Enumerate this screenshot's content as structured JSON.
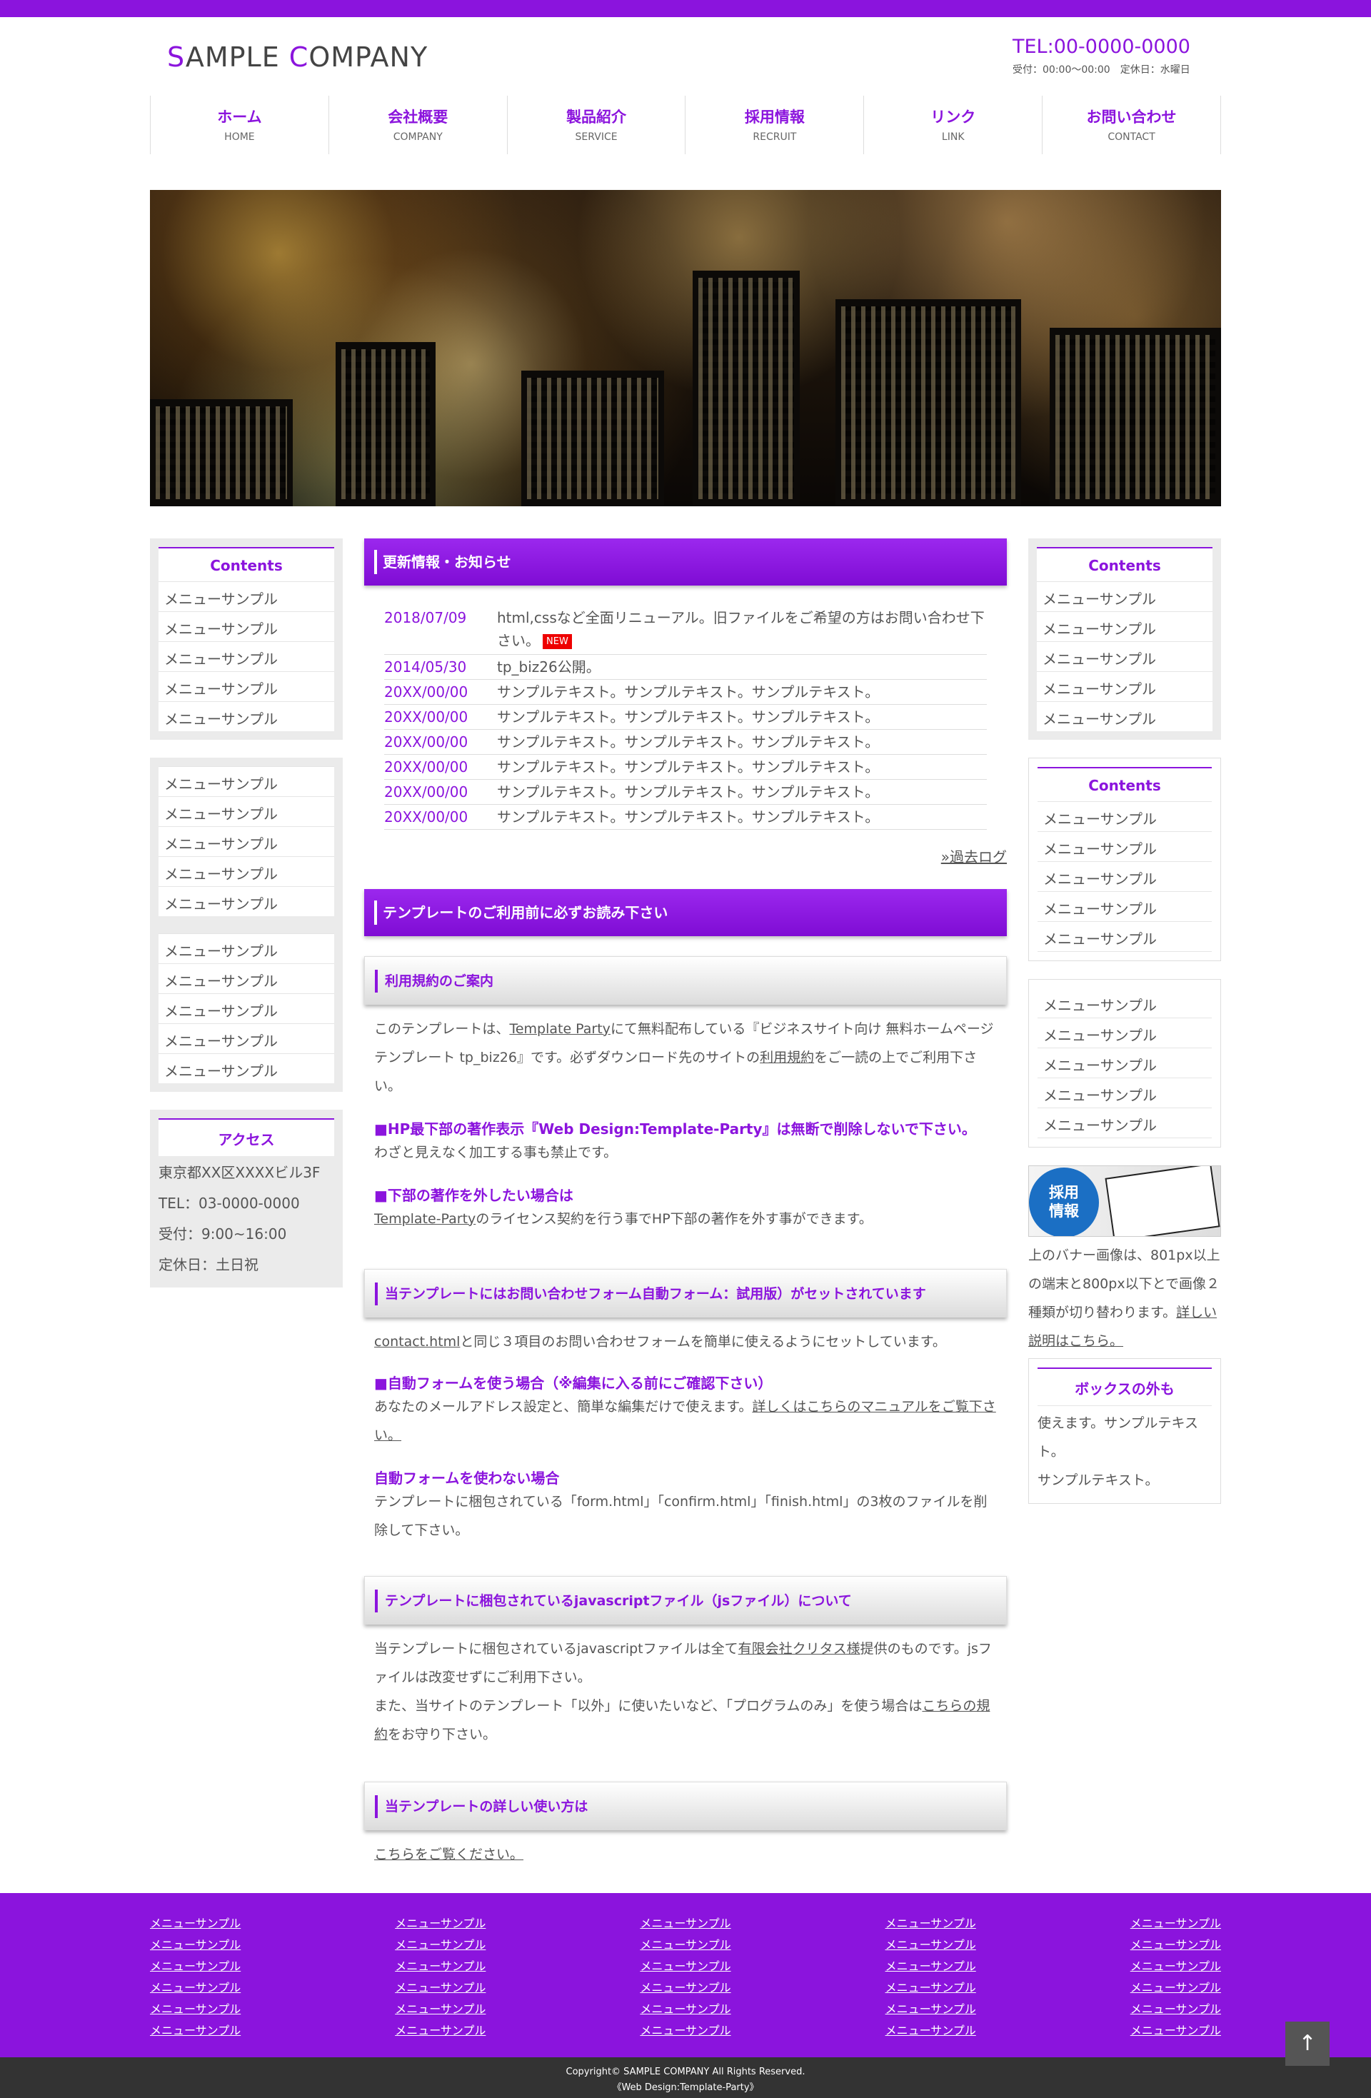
{
  "header": {
    "logo": {
      "first_initial": "S",
      "first_rest": "AMPLE ",
      "second_initial": "C",
      "second_rest": "OMPANY"
    },
    "tel": "TEL:00-0000-0000",
    "hours": "受付：00:00～00:00　定休日：水曜日"
  },
  "nav": [
    {
      "jp": "ホーム",
      "en": "HOME"
    },
    {
      "jp": "会社概要",
      "en": "COMPANY"
    },
    {
      "jp": "製品紹介",
      "en": "SERVICE"
    },
    {
      "jp": "採用情報",
      "en": "RECRUIT"
    },
    {
      "jp": "リンク",
      "en": "LINK"
    },
    {
      "jp": "お問い合わせ",
      "en": "CONTACT"
    }
  ],
  "left": {
    "box1_title": "Contents",
    "box1_items": [
      "メニューサンプル",
      "メニューサンプル",
      "メニューサンプル",
      "メニューサンプル",
      "メニューサンプル"
    ],
    "box2_items": [
      "メニューサンプル",
      "メニューサンプル",
      "メニューサンプル",
      "メニューサンプル",
      "メニューサンプル"
    ],
    "box3_items": [
      "メニューサンプル",
      "メニューサンプル",
      "メニューサンプル",
      "メニューサンプル",
      "メニューサンプル"
    ],
    "access_title": "アクセス",
    "access_lines": [
      "東京都XX区XXXXビル3F",
      "TEL：03-0000-0000",
      "受付：9:00~16:00",
      "定休日：土日祝"
    ]
  },
  "news": {
    "title": "更新情報・お知らせ",
    "badge": "NEW",
    "items": [
      {
        "date": "2018/07/09",
        "text": "html,cssなど全面リニューアル。旧ファイルをご希望の方はお問い合わせ下さい。"
      },
      {
        "date": "2014/05/30",
        "text": "tp_biz26公開。"
      },
      {
        "date": "20XX/00/00",
        "text": "サンプルテキスト。サンプルテキスト。サンプルテキスト。"
      },
      {
        "date": "20XX/00/00",
        "text": "サンプルテキスト。サンプルテキスト。サンプルテキスト。"
      },
      {
        "date": "20XX/00/00",
        "text": "サンプルテキスト。サンプルテキスト。サンプルテキスト。"
      },
      {
        "date": "20XX/00/00",
        "text": "サンプルテキスト。サンプルテキスト。サンプルテキスト。"
      },
      {
        "date": "20XX/00/00",
        "text": "サンプルテキスト。サンプルテキスト。サンプルテキスト。"
      },
      {
        "date": "20XX/00/00",
        "text": "サンプルテキスト。サンプルテキスト。サンプルテキスト。"
      }
    ],
    "past_log": "»過去ログ"
  },
  "template": {
    "title": "テンプレートのご利用前に必ずお読み下さい",
    "terms_head": "利用規約のご案内",
    "terms_p1": "このテンプレートは、",
    "terms_link1": "Template Party",
    "terms_p2": "にて無料配布している『ビジネスサイト向け 無料ホームページテンプレート tp_biz26』です。必ずダウンロード先のサイトの",
    "terms_link2": "利用規約",
    "terms_p3": "をご一読の上でご利用下さい。",
    "copyright_head": "■HP最下部の著作表示『Web Design:Template-Party』は無断で削除しないで下さい。",
    "copyright_body": "わざと見えなく加工する事も禁止です。",
    "remove_head": "■下部の著作を外したい場合は",
    "remove_link": "Template-Party",
    "remove_body": "のライセンス契約を行う事でHP下部の著作を外す事ができます。",
    "form_head": "当テンプレートにはお問い合わせフォーム自動フォーム：試用版）がセットされています",
    "form_link": "contact.html",
    "form_body": "と同じ３項目のお問い合わせフォームを簡単に使えるようにセットしています。",
    "auto_head": "■自動フォームを使う場合（※編集に入る前にご確認下さい）",
    "auto_body": "あなたのメールアドレス設定と、簡単な編集だけで使えます。",
    "auto_link": "詳しくはこちらのマニュアルをご覧下さい。",
    "noauto_head": "自動フォームを使わない場合",
    "noauto_body": "テンプレートに梱包されている「form.html」「confirm.html」「finish.html」の3枚のファイルを削除して下さい。",
    "js_head": "テンプレートに梱包されているjavascriptファイル（jsファイル）について",
    "js_p1": "当テンプレートに梱包されているjavascriptファイルは全て",
    "js_link1": "有限会社クリタス様",
    "js_p2": "提供のものです。jsファイルは改変せずにご利用下さい。",
    "js_p3": "また、当サイトのテンプレート「以外」に使いたいなど、「プログラムのみ」を使う場合は",
    "js_link2": "こちらの規約",
    "js_p4": "をお守り下さい。",
    "howto_head": "当テンプレートの詳しい使い方は",
    "howto_link": "こちらをご覧ください。"
  },
  "right": {
    "box1_title": "Contents",
    "box1_items": [
      "メニューサンプル",
      "メニューサンプル",
      "メニューサンプル",
      "メニューサンプル",
      "メニューサンプル"
    ],
    "box2_title": "Contents",
    "box2_items": [
      "メニューサンプル",
      "メニューサンプル",
      "メニューサンプル",
      "メニューサンプル",
      "メニューサンプル"
    ],
    "box3_items": [
      "メニューサンプル",
      "メニューサンプル",
      "メニューサンプル",
      "メニューサンプル",
      "メニューサンプル"
    ],
    "banner_text_1": "採用",
    "banner_text_2": "情報",
    "banner_desc": "上のバナー画像は、801px以上の端末と800px以下とで画像２種類が切り替わります。",
    "banner_link": "詳しい説明はこちら。",
    "outbox_title": "ボックスの外も",
    "outbox_p1": "使えます。サンプルテキスト。",
    "outbox_p2": "サンプルテキスト。"
  },
  "footer": {
    "columns": [
      [
        "メニューサンプル",
        "メニューサンプル",
        "メニューサンプル",
        "メニューサンプル",
        "メニューサンプル",
        "メニューサンプル"
      ],
      [
        "メニューサンプル",
        "メニューサンプル",
        "メニューサンプル",
        "メニューサンプル",
        "メニューサンプル",
        "メニューサンプル"
      ],
      [
        "メニューサンプル",
        "メニューサンプル",
        "メニューサンプル",
        "メニューサンプル",
        "メニューサンプル",
        "メニューサンプル"
      ],
      [
        "メニューサンプル",
        "メニューサンプル",
        "メニューサンプル",
        "メニューサンプル",
        "メニューサンプル",
        "メニューサンプル"
      ],
      [
        "メニューサンプル",
        "メニューサンプル",
        "メニューサンプル",
        "メニューサンプル",
        "メニューサンプル",
        "メニューサンプル"
      ]
    ],
    "pagetop_icon": "arrow-up-icon",
    "copyright": "Copyright© SAMPLE COMPANY All Rights Reserved.",
    "credit": "《Web Design:Template-Party》"
  },
  "colors": {
    "accent": "#8b14dd",
    "footer_dark": "#333333"
  }
}
